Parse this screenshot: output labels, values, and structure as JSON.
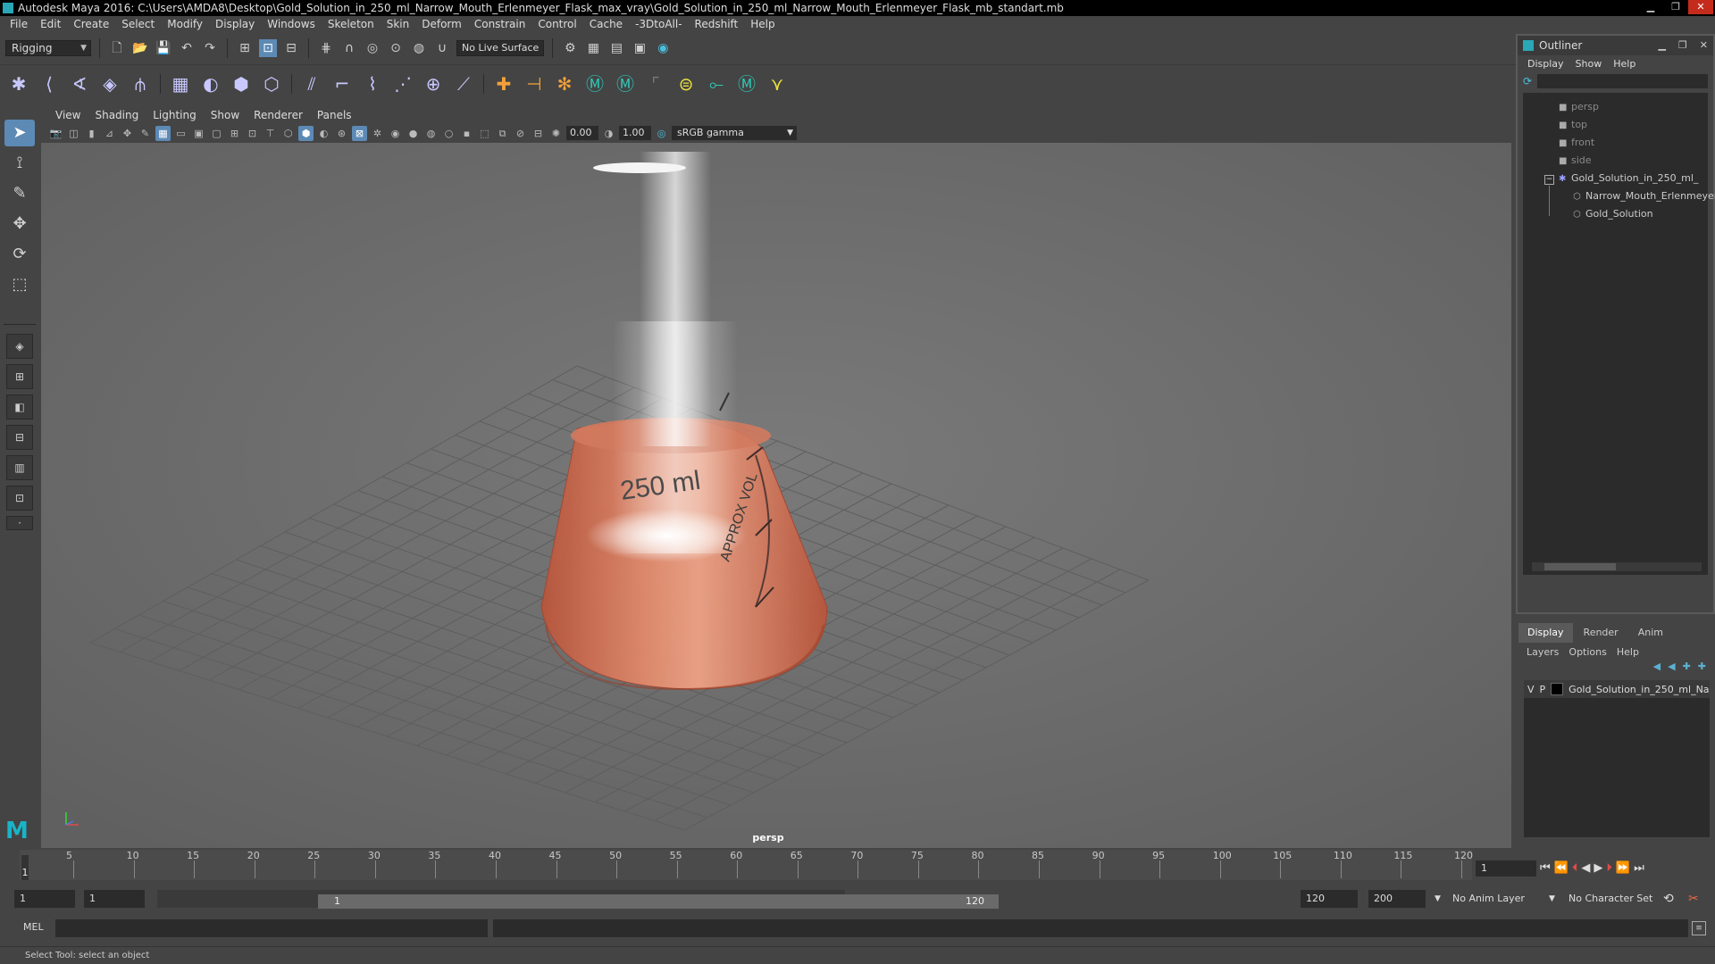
{
  "window": {
    "title": "Autodesk Maya 2016: C:\\Users\\AMDA8\\Desktop\\Gold_Solution_in_250_ml_Narrow_Mouth_Erlenmeyer_Flask_max_vray\\Gold_Solution_in_250_ml_Narrow_Mouth_Erlenmeyer_Flask_mb_standart.mb",
    "minimize": "▁",
    "maximize": "❐",
    "close": "✕"
  },
  "menubar": [
    "File",
    "Edit",
    "Create",
    "Select",
    "Modify",
    "Display",
    "Windows",
    "Skeleton",
    "Skin",
    "Deform",
    "Constrain",
    "Control",
    "Cache",
    "-3DtoAll-",
    "Redshift",
    "Help"
  ],
  "statusline": {
    "menuset": "Rigging",
    "live_surface": "No Live Surface"
  },
  "viewport": {
    "menus": [
      "View",
      "Shading",
      "Lighting",
      "Show",
      "Renderer",
      "Panels"
    ],
    "exposure": "0.00",
    "gamma": "1.00",
    "color_management": "sRGB gamma",
    "camera_label": "persp",
    "flask_text_volume": "250 ml",
    "flask_text_approx": "APPROX VOL"
  },
  "outliner": {
    "title": "Outliner",
    "menus": [
      "Display",
      "Show",
      "Help"
    ],
    "items": [
      {
        "label": "persp",
        "kind": "camera"
      },
      {
        "label": "top",
        "kind": "camera"
      },
      {
        "label": "front",
        "kind": "camera"
      },
      {
        "label": "side",
        "kind": "camera"
      },
      {
        "label": "Gold_Solution_in_250_ml_",
        "kind": "group"
      },
      {
        "label": "Narrow_Mouth_Erlenmeyer",
        "kind": "mesh"
      },
      {
        "label": "Gold_Solution",
        "kind": "mesh"
      }
    ]
  },
  "layer_editor": {
    "tabs": [
      "Display",
      "Render",
      "Anim"
    ],
    "active_tab": "Display",
    "menus": [
      "Layers",
      "Options",
      "Help"
    ],
    "layers": [
      {
        "visible": "V",
        "playback": "P",
        "name": "Gold_Solution_in_250_ml_Na"
      }
    ]
  },
  "timeline": {
    "ticks": [
      "1",
      "5",
      "10",
      "15",
      "20",
      "25",
      "30",
      "35",
      "40",
      "45",
      "50",
      "55",
      "60",
      "65",
      "70",
      "75",
      "80",
      "85",
      "90",
      "95",
      "100",
      "105",
      "110",
      "115",
      "120"
    ],
    "current_frame": "1"
  },
  "range": {
    "start": "1",
    "playback_start": "1",
    "handle_start": "1",
    "handle_end": "120",
    "playback_end": "120",
    "end": "200",
    "anim_layer": "No Anim Layer",
    "character_set": "No Character Set"
  },
  "cmdline": {
    "label": "MEL"
  },
  "helpline": "Select Tool: select an object",
  "colors": {
    "accent": "#5c8ab5",
    "liquid": "#d8765a",
    "viewport_bg": "#707070"
  }
}
